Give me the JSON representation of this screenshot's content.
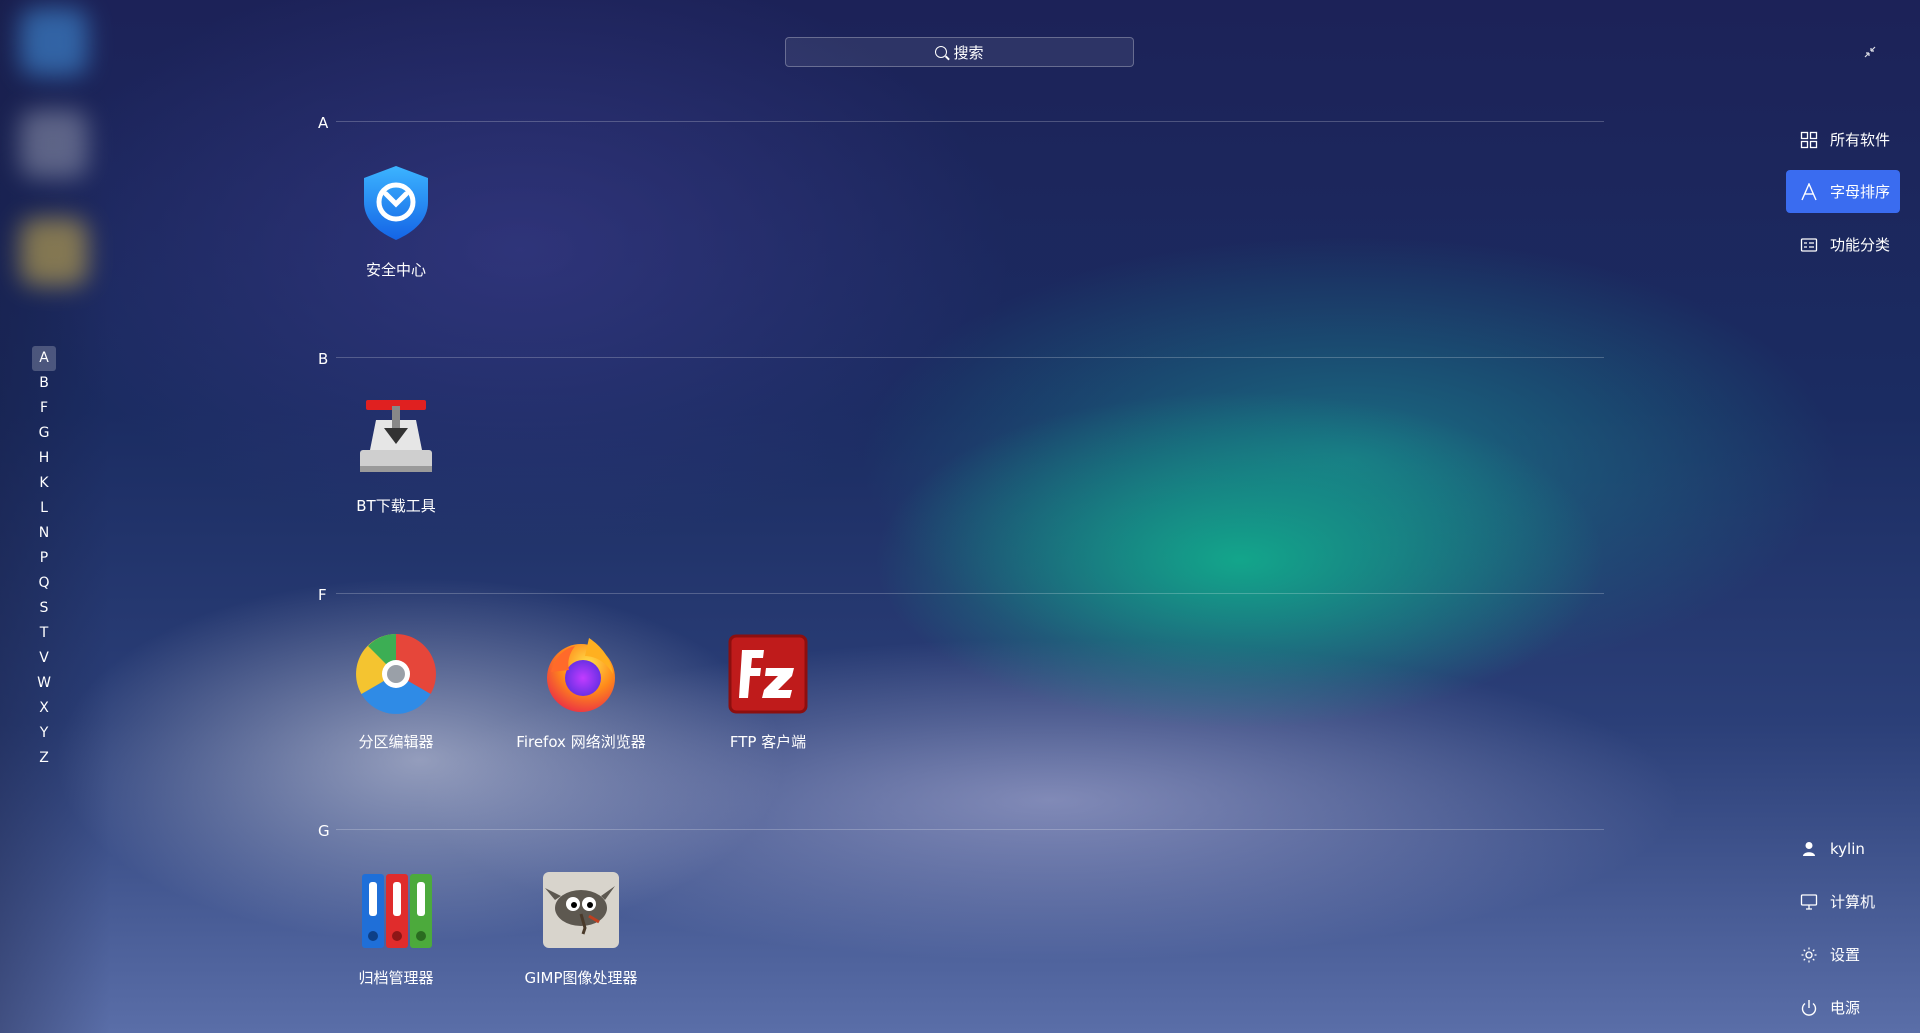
{
  "search": {
    "placeholder": "搜索"
  },
  "letter_index": [
    "A",
    "B",
    "F",
    "G",
    "H",
    "K",
    "L",
    "N",
    "P",
    "Q",
    "S",
    "T",
    "V",
    "W",
    "X",
    "Y",
    "Z"
  ],
  "active_letter": "A",
  "sections": [
    {
      "letter": "A",
      "apps": [
        {
          "name": "安全中心",
          "icon": "security-center-icon"
        }
      ]
    },
    {
      "letter": "B",
      "apps": [
        {
          "name": "BT下载工具",
          "icon": "bt-download-icon"
        }
      ]
    },
    {
      "letter": "F",
      "apps": [
        {
          "name": "分区编辑器",
          "icon": "partition-editor-icon"
        },
        {
          "name": "Firefox 网络浏览器",
          "icon": "firefox-icon"
        },
        {
          "name": "FTP 客户端",
          "icon": "filezilla-icon"
        }
      ]
    },
    {
      "letter": "G",
      "apps": [
        {
          "name": "归档管理器",
          "icon": "archive-manager-icon"
        },
        {
          "name": "GIMP图像处理器",
          "icon": "gimp-icon"
        }
      ]
    }
  ],
  "view_modes": [
    {
      "label": "所有软件",
      "icon": "grid-icon",
      "active": false
    },
    {
      "label": "字母排序",
      "icon": "letter-sort-icon",
      "active": true
    },
    {
      "label": "功能分类",
      "icon": "category-icon",
      "active": false
    }
  ],
  "bottom_menu": [
    {
      "label": "kylin",
      "icon": "user-icon"
    },
    {
      "label": "计算机",
      "icon": "computer-icon"
    },
    {
      "label": "设置",
      "icon": "settings-icon"
    },
    {
      "label": "电源",
      "icon": "power-icon"
    }
  ],
  "colors": {
    "accent": "#3a6cf0"
  }
}
